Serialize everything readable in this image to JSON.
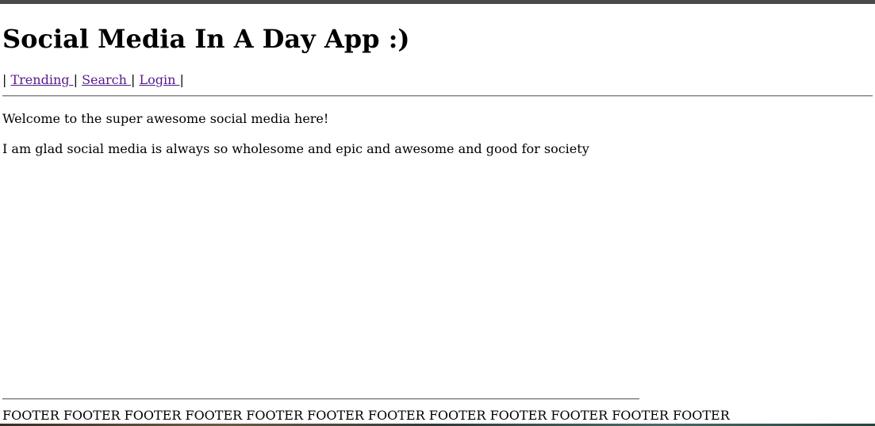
{
  "header": {
    "title": "Social Media In A Day App :)"
  },
  "nav": {
    "separator": "|",
    "links": [
      {
        "label": "Trending"
      },
      {
        "label": "Search"
      },
      {
        "label": "Login"
      }
    ]
  },
  "main": {
    "welcome": "Welcome to the super awesome social media here!",
    "message": "I am glad social media is always so wholesome and epic and awesome and good for society"
  },
  "footer": {
    "text": "FOOTER FOOTER FOOTER FOOTER FOOTER FOOTER FOOTER FOOTER FOOTER FOOTER FOOTER FOOTER"
  },
  "colors": {
    "link": "#551a8b",
    "top_strip": "#4a4a4a"
  }
}
